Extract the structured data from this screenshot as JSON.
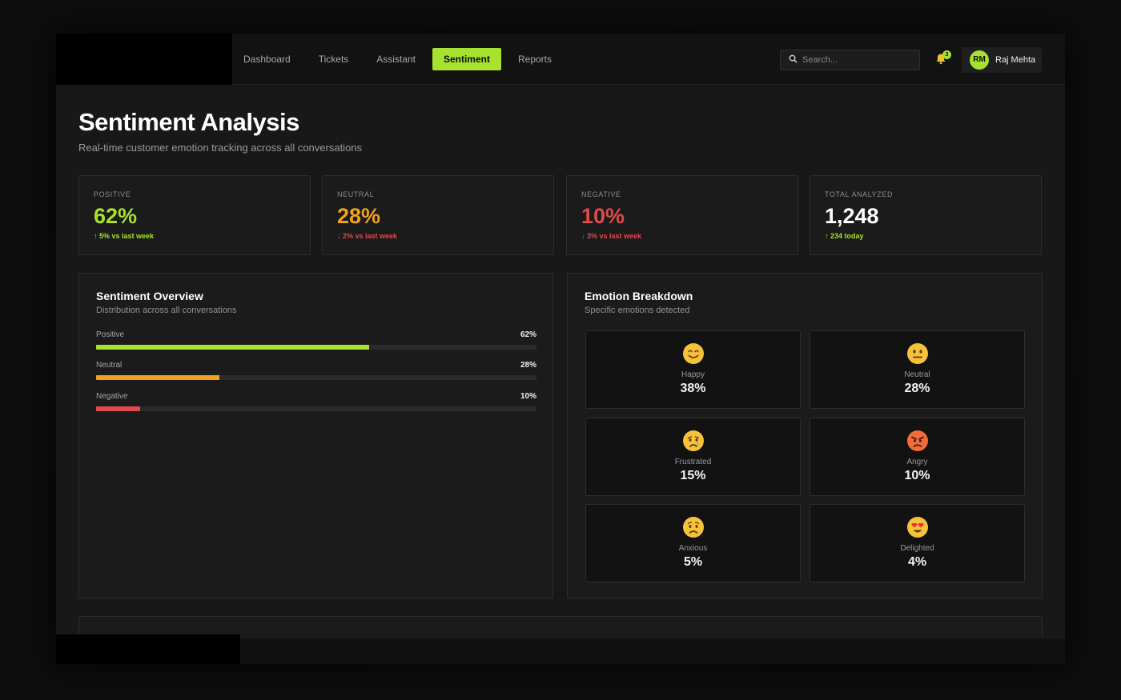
{
  "nav": {
    "links": [
      "Dashboard",
      "Tickets",
      "Assistant",
      "Sentiment",
      "Reports"
    ],
    "active_index": 3,
    "search_placeholder": "Search...",
    "notification_count": "3",
    "user_initials": "RM",
    "user_name": "Raj Mehta"
  },
  "header": {
    "title": "Sentiment Analysis",
    "subtitle": "Real-time customer emotion tracking across all conversations"
  },
  "stats": [
    {
      "label": "POSITIVE",
      "value": "62%",
      "change": "↑ 5% vs last week",
      "color": "#a6e22e",
      "change_color": "#a6e22e"
    },
    {
      "label": "NEUTRAL",
      "value": "28%",
      "change": "↓ 2% vs last week",
      "color": "#f0a01e",
      "change_color": "#e04a4a"
    },
    {
      "label": "NEGATIVE",
      "value": "10%",
      "change": "↓ 3% vs last week",
      "color": "#e04a4a",
      "change_color": "#e04a4a"
    },
    {
      "label": "TOTAL ANALYZED",
      "value": "1,248",
      "change": "↑ 234 today",
      "color": "#ffffff",
      "change_color": "#a6e22e"
    }
  ],
  "overview": {
    "title": "Sentiment Overview",
    "subtitle": "Distribution across all conversations",
    "bars": [
      {
        "label": "Positive",
        "pct_text": "62%",
        "value": 62,
        "color": "#a6e22e"
      },
      {
        "label": "Neutral",
        "pct_text": "28%",
        "value": 28,
        "color": "#f0a01e"
      },
      {
        "label": "Negative",
        "pct_text": "10%",
        "value": 10,
        "color": "#e04a4a"
      }
    ]
  },
  "emotions": {
    "title": "Emotion Breakdown",
    "subtitle": "Specific emotions detected",
    "items": [
      {
        "name": "Happy",
        "pct": "38%",
        "icon": "smiling-face-icon"
      },
      {
        "name": "Neutral",
        "pct": "28%",
        "icon": "neutral-face-icon"
      },
      {
        "name": "Frustrated",
        "pct": "15%",
        "icon": "crying-face-icon"
      },
      {
        "name": "Angry",
        "pct": "10%",
        "icon": "angry-face-icon"
      },
      {
        "name": "Anxious",
        "pct": "5%",
        "icon": "worried-face-icon"
      },
      {
        "name": "Delighted",
        "pct": "4%",
        "icon": "heart-eyes-face-icon"
      }
    ]
  },
  "colors": {
    "accent": "#a6e22e",
    "warning": "#f0a01e",
    "danger": "#e04a4a",
    "background": "#181818"
  }
}
